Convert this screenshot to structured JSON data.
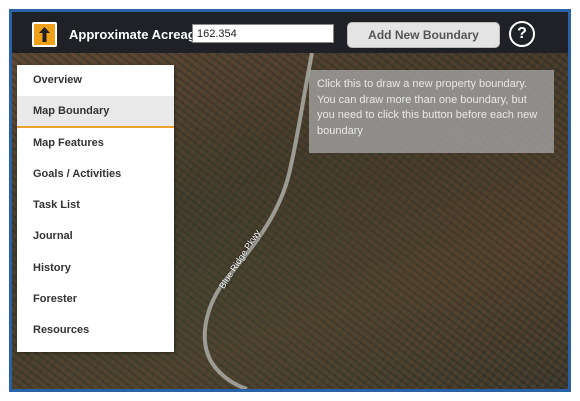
{
  "toolbar": {
    "folder_icon": "upload-folder-icon",
    "acreage_label": "Approximate Acreage:",
    "acreage_value": "162.354",
    "add_boundary_label": "Add New Boundary",
    "help_label": "?"
  },
  "sidebar": {
    "items": [
      {
        "label": "Overview"
      },
      {
        "label": "Map Boundary"
      },
      {
        "label": "Map Features"
      },
      {
        "label": "Goals / Activities"
      },
      {
        "label": "Task List"
      },
      {
        "label": "Journal"
      },
      {
        "label": "History"
      },
      {
        "label": "Forester"
      },
      {
        "label": "Resources"
      }
    ],
    "active_index": 1
  },
  "tooltip": {
    "text": "Click this to draw a new property boundary. You can draw more than one boundary, but you need to click this button before each new boundary"
  },
  "map": {
    "road_label": "Blue Ridge Pkwy"
  },
  "colors": {
    "frame": "#2a62a8",
    "toolbar": "#1f2126",
    "accent": "#f0a11a",
    "active_underline": "#e9a12c"
  }
}
